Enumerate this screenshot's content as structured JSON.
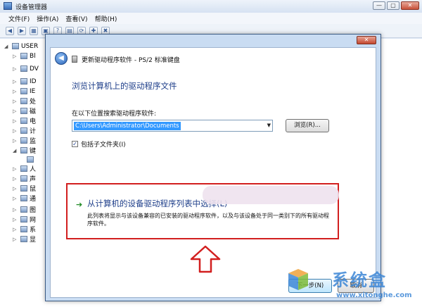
{
  "background_window": {
    "title": "设备管理器",
    "caption_buttons": [
      "—",
      "▢",
      "✕"
    ],
    "menu": [
      "文件(F)",
      "操作(A)",
      "查看(V)",
      "帮助(H)"
    ],
    "toolbar": [
      "◀",
      "▶",
      "▦",
      "▣",
      "?",
      "▤",
      "⟳",
      "✚",
      "✖"
    ],
    "tree_root": "USER",
    "tree_items": [
      "Bl",
      "DV",
      "ID",
      "IE",
      "处",
      "磁",
      "电",
      "计",
      "监",
      "键",
      "",
      "人",
      "声",
      "鼠",
      "通",
      "图",
      "网",
      "系",
      "显"
    ]
  },
  "dialog": {
    "close_glyph": "✕",
    "back_glyph": "◀",
    "header_title": "更新驱动程序软件 - PS/2 标准键盘",
    "heading": "浏览计算机上的驱动程序文件",
    "search_label": "在以下位置搜索驱动程序软件:",
    "path_value": "C:\\Users\\Administrator\\Documents",
    "combo_arrow": "▼",
    "browse_label": "浏览(R)...",
    "include_subfolders_label": "包括子文件夹(I)",
    "include_subfolders_checked": "✓",
    "option_arrow": "➔",
    "option_title": "从计算机的设备驱动程序列表中选择(L)",
    "option_description": "此列表将显示与该设备兼容的已安装的驱动程序软件，以及与该设备处于同一类别下的所有驱动程序软件。",
    "next_label": "下一步(N)",
    "cancel_label": "取消"
  },
  "annotation": {
    "highlight_color": "#d21f1f"
  },
  "watermark": {
    "brand": "系统盒",
    "url": "www.xitonghe.com",
    "color": "#3d87d6"
  }
}
